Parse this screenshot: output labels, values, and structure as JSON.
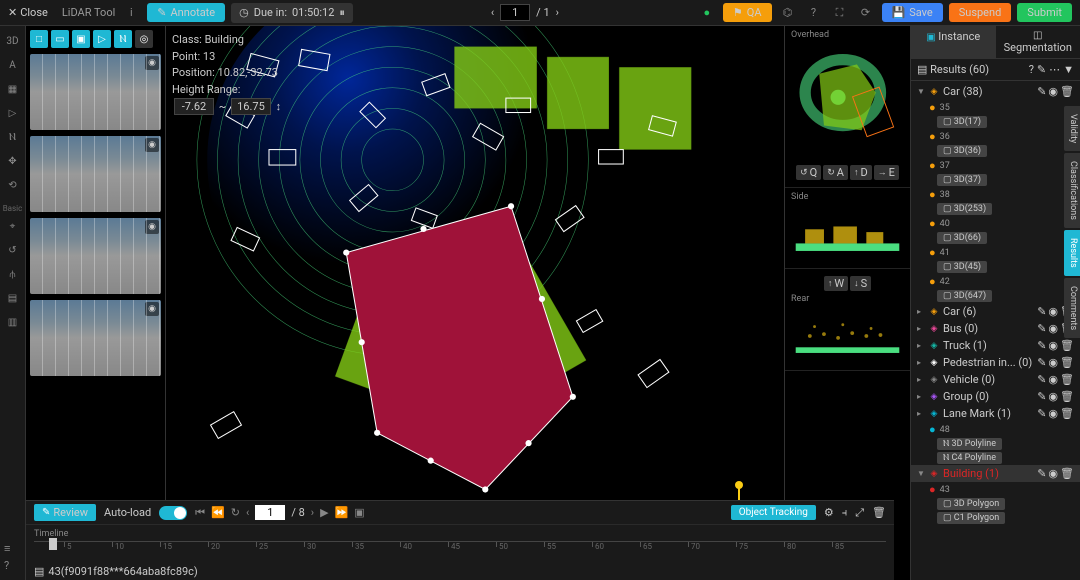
{
  "header": {
    "close": "Close",
    "tool": "LiDAR Tool",
    "annotate": "Annotate",
    "due_prefix": "Due in:",
    "due_time": "01:50:12",
    "page_cur": "1",
    "page_total": "/ 1",
    "qa": "QA",
    "save": "Save",
    "suspend": "Suspend",
    "submit": "Submit"
  },
  "left_labels": {
    "basic": "Basic"
  },
  "info": {
    "class_lbl": "Class:",
    "class_val": "Building",
    "point_lbl": "Point:",
    "point_val": "13",
    "pos_lbl": "Position:",
    "pos_val": "10.82,-32.73",
    "hr_lbl": "Height Range:",
    "hr_min": "-7.62",
    "hr_max": "16.75"
  },
  "side": {
    "overhead": "Overhead",
    "side": "Side",
    "rear": "Rear",
    "kq": "Q",
    "ka": "A",
    "kd": "D",
    "ke": "E",
    "kw": "W",
    "ks": "S"
  },
  "rp": {
    "tab_instance": "Instance",
    "tab_segment": "Segmentation",
    "results": "Results (60)",
    "categories": [
      {
        "name": "Car (38)",
        "color": "#f59e0b",
        "open": true
      },
      {
        "name": "Car (6)",
        "color": "#f59e0b"
      },
      {
        "name": "Bus (0)",
        "color": "#ec4899"
      },
      {
        "name": "Truck (1)",
        "color": "#14b8a6"
      },
      {
        "name": "Pedestrian in... (0)",
        "color": "#fff"
      },
      {
        "name": "Vehicle (0)",
        "color": "#888"
      },
      {
        "name": "Group (0)",
        "color": "#a855f7"
      },
      {
        "name": "Lane Mark (1)",
        "color": "#06b6d4"
      }
    ],
    "car_items": [
      {
        "id": "35",
        "tag": "3D(17)"
      },
      {
        "id": "36",
        "tag": "3D(36)"
      },
      {
        "id": "37",
        "tag": "3D(37)"
      },
      {
        "id": "38",
        "tag": "3D(253)"
      },
      {
        "id": "40",
        "tag": "3D(66)"
      },
      {
        "id": "41",
        "tag": "3D(45)"
      },
      {
        "id": "42",
        "tag": "3D(647)"
      }
    ],
    "lane_id": "48",
    "lane_a": "3D Polyline",
    "lane_b": "C4 Polyline",
    "building": "Building (1)",
    "building_id": "43",
    "building_a": "3D Polygon",
    "building_b": "C1 Polygon"
  },
  "vtabs": {
    "validity": "Validity",
    "classif": "Classifications",
    "results": "Results",
    "comments": "Comments"
  },
  "bottom": {
    "review": "Review",
    "autoload": "Auto-load",
    "frame_cur": "1",
    "frame_total": "/ 8",
    "obj_track": "Object Tracking",
    "timeline": "Timeline",
    "ticks": [
      "5",
      "10",
      "15",
      "20",
      "25",
      "30",
      "35",
      "40",
      "45",
      "50",
      "55",
      "60",
      "65",
      "70",
      "75",
      "80",
      "85"
    ],
    "file": "43(f9091f88***664aba8fc89c)"
  }
}
